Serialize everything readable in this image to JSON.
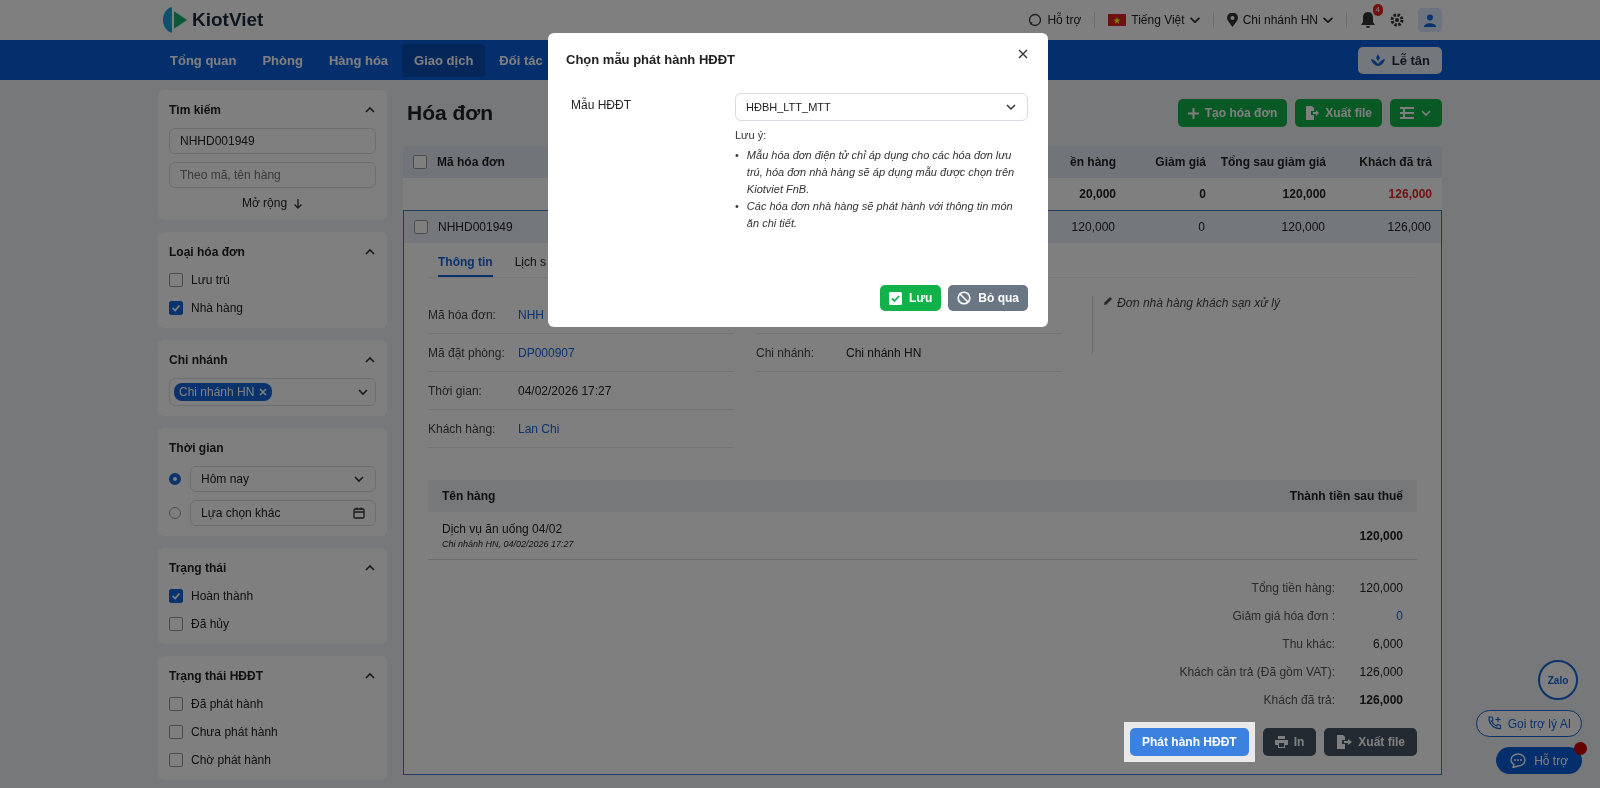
{
  "header": {
    "logo": "KiotViet",
    "help": "Hỗ trợ",
    "language": "Tiếng Việt",
    "branch": "Chi nhánh HN",
    "notification_count": "4"
  },
  "nav": {
    "items": [
      {
        "label": "Tổng quan",
        "selected": false
      },
      {
        "label": "Phòng",
        "selected": false
      },
      {
        "label": "Hàng hóa",
        "selected": false
      },
      {
        "label": "Giao dịch",
        "selected": true
      },
      {
        "label": "Đối tác",
        "selected": false
      }
    ],
    "reception_button": "Lễ tân"
  },
  "sidebar": {
    "search": {
      "title": "Tìm kiếm",
      "value": "NHHD001949",
      "placeholder": "Theo mã, tên hàng",
      "expand": "Mở rộng"
    },
    "invoice_type": {
      "title": "Loại hóa đơn",
      "options": [
        {
          "label": "Lưu trú",
          "checked": false
        },
        {
          "label": "Nhà hàng",
          "checked": true
        }
      ]
    },
    "branch": {
      "title": "Chi nhánh",
      "tags": [
        "Chi nhánh HN"
      ]
    },
    "time": {
      "title": "Thời gian",
      "options": [
        {
          "kind": "select",
          "label": "Hôm nay",
          "selected": true
        },
        {
          "kind": "date",
          "label": "Lựa chọn khác",
          "selected": false
        }
      ]
    },
    "status": {
      "title": "Trạng thái",
      "options": [
        {
          "label": "Hoàn thành",
          "checked": true
        },
        {
          "label": "Đã hủy",
          "checked": false
        }
      ]
    },
    "einvoice_status": {
      "title": "Trạng thái HĐĐT",
      "options": [
        {
          "label": "Đã phát hành",
          "checked": false
        },
        {
          "label": "Chưa phát hành",
          "checked": false
        },
        {
          "label": "Chờ phát hành",
          "checked": false
        }
      ]
    }
  },
  "page": {
    "title": "Hóa đơn",
    "create_button": "Tạo hóa đơn",
    "export_button": "Xuất file"
  },
  "table": {
    "select_all_checked": false,
    "columns": [
      "Mã hóa đơn",
      "ền hàng",
      "Giảm giá",
      "Tổng sau giảm giá",
      "Khách đã trả"
    ],
    "summary": {
      "amount": "20,000",
      "discount": "0",
      "after_discount": "120,000",
      "paid": "126,000"
    },
    "rows": [
      {
        "checked": false,
        "cells": [
          "NHHD001949",
          "120,000",
          "0",
          "120,000",
          "126,000"
        ]
      }
    ]
  },
  "detail": {
    "tabs": [
      {
        "label": "Thông tin",
        "selected": true
      },
      {
        "label": "Lịch s",
        "selected": false
      }
    ],
    "fields": [
      {
        "label": "Mã hóa đơn:",
        "value": "NHH",
        "link": true
      },
      {
        "label": "Mã đặt phòng:",
        "value": "DP000907",
        "link": true
      },
      {
        "label": "Thời gian:",
        "value": "04/02/2026 17:27",
        "link": false
      },
      {
        "label": "Khách hàng:",
        "value": "Lan Chi",
        "link": true
      }
    ],
    "branch_field": {
      "label": "Chi nhánh:",
      "value": "Chi nhánh HN"
    },
    "note": "Đơn nhà hàng khách sạn xử lý",
    "items_columns": [
      "Tên hàng",
      "Thành tiền sau thuế"
    ],
    "items": [
      {
        "name": "Dịch vụ ăn uống 04/02",
        "sub": "Chi nhánh HN, 04/02/2026 17:27",
        "amount": "120,000"
      }
    ],
    "totals": [
      {
        "label": "Tổng tiền hàng:",
        "value": "120,000",
        "kind": "plain"
      },
      {
        "label": "Giảm giá hóa đơn :",
        "value": "0",
        "kind": "link"
      },
      {
        "label": "Thu khác:",
        "value": "6,000",
        "kind": "plain"
      },
      {
        "label": "Khách cần trả (Đã gồm VAT):",
        "value": "126,000",
        "kind": "plain"
      },
      {
        "label": "Khách đã trả:",
        "value": "126,000",
        "kind": "bold"
      }
    ],
    "actions": [
      {
        "label": "Phát hành HĐĐT",
        "kind": "primary"
      },
      {
        "label": "In",
        "kind": "print"
      },
      {
        "label": "Xuất file",
        "kind": "export"
      }
    ]
  },
  "floating": {
    "zalo": "Zalo",
    "ai_button": "Gọi trợ lý AI",
    "support_button": "Hỗ trợ"
  },
  "modal": {
    "title": "Chọn mẫu phát hành HĐĐT",
    "field_label": "Mẫu HĐĐT",
    "field_value": "HĐBH_LTT_MTT",
    "note_title": "Lưu ý:",
    "notes": [
      {
        "bullet": "•",
        "text": "Mẫu hóa đơn điện tử chỉ áp dụng cho các hóa đơn lưu trú, hóa đơn nhà hàng sẽ áp dụng mẫu được chọn trên Kiotviet FnB."
      },
      {
        "bullet": "•",
        "text": "Các hóa đơn nhà hàng sẽ phát hành với thông tin món ăn chi tiết."
      }
    ],
    "save_button": "Lưu",
    "cancel_button": "Bỏ qua"
  }
}
